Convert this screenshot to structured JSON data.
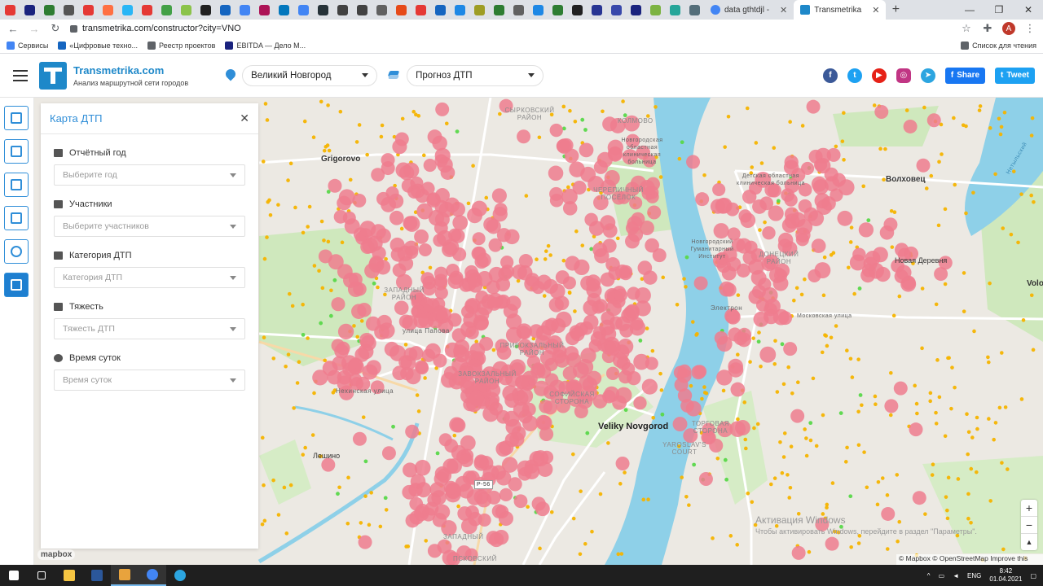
{
  "browser": {
    "tabs": [
      {
        "title": "data gthtdjl -",
        "active": false
      },
      {
        "title": "Transmetrika",
        "active": true
      }
    ],
    "url": "transmetrika.com/constructor?city=VNO",
    "profile_initial": "A",
    "bookmarks": [
      "Сервисы",
      "«Цифровые техно...",
      "Реестр проектов",
      "EBITDA — Дело М..."
    ],
    "reading_list": "Список для чтения"
  },
  "header": {
    "brand_name": "Transmetrika.com",
    "brand_tagline": "Анализ маршрутной сети городов",
    "city_select": "Великий Новгород",
    "layer_select": "Прогноз ДТП",
    "share_label": "Share",
    "tweet_label": "Tweet",
    "social_icons": [
      "facebook-icon",
      "twitter-icon",
      "youtube-icon",
      "instagram-icon",
      "telegram-icon"
    ]
  },
  "rail": {
    "items": [
      "analytics-icon",
      "bus-icon",
      "route-icon",
      "route-edit-icon",
      "stop-icon",
      "crash-icon"
    ],
    "active_index": 5
  },
  "panel": {
    "title": "Карта ДТП",
    "filters": [
      {
        "label": "Отчётный год",
        "placeholder": "Выберите год",
        "icon": "calendar-icon"
      },
      {
        "label": "Участники",
        "placeholder": "Выберите участников",
        "icon": "users-icon"
      },
      {
        "label": "Категория ДТП",
        "placeholder": "Категория ДТП",
        "icon": "car-crash-icon"
      },
      {
        "label": "Тяжесть",
        "placeholder": "Тяжесть ДТП",
        "icon": "ambulance-icon"
      },
      {
        "label": "Время суток",
        "placeholder": "Время суток",
        "icon": "clock-icon"
      }
    ]
  },
  "map": {
    "labels": {
      "grigorovo": "Grigorovo",
      "volhovec": "Волховец",
      "novaya_derevnya": "Новая Деревня",
      "volotovo": "Volotov",
      "veliky_novgorod": "Veliky Novgorod",
      "leshino": "Лешино",
      "syrkovsky": "СЫРКОВСКИЙ РАЙОН",
      "kolmovo": "КОЛМОВО",
      "hospital1": "Новгородская областная клиническая больница",
      "cherepichny": "ЧЕРЕПИЧНЫЙ ПОСЁЛОК",
      "institute": "Новгородский Гуманитарный Институт",
      "zapadny": "ЗАПАДНЫЙ РАЙОН",
      "privokzalny": "ПРИВОКЗАЛЬНЫЙ РАЙОН",
      "zavokzalny": "ЗАВОКЗАЛЬНЫЙ РАЙОН",
      "sofiyskaya": "СОФИЙСКАЯ СТОРОНА",
      "torgovaya": "ТОРГОВАЯ СТОРОНА",
      "yaroslavov": "YAROSLAV'S COURT",
      "donetsky": "ДОНЕЦКИЙ РАЙОН",
      "hospital2": "Детская областная клиническая больница",
      "elektron": "Электрон",
      "moskovskaya": "Московская улица",
      "papova": "улица Папова",
      "nehinskaya": "Нехинская улица",
      "pskovsky": "ПСКОВСКИЙ",
      "zapadny_small": "ЗАПАДНЫЙ",
      "road_r56": "Р-56",
      "river": "Нетыльский"
    },
    "zoom_in": "+",
    "zoom_out": "−",
    "mapbox": "mapbox",
    "attribution": "© Mapbox © OpenStreetMap  Improve this map",
    "activation_title": "Активация Windows",
    "activation_sub": "Чтобы активировать Windows, перейдите в раздел \"Параметры\"."
  },
  "taskbar": {
    "lang": "ENG",
    "time": "8:42",
    "date": "01.04.2021"
  },
  "colors": {
    "accent": "#2f8ed8",
    "accident_major": "#ee7d8e",
    "accident_minor": "#f5b400",
    "accident_green": "#5ad84a",
    "water": "#8ed0e8",
    "park": "#c9e6b5"
  }
}
